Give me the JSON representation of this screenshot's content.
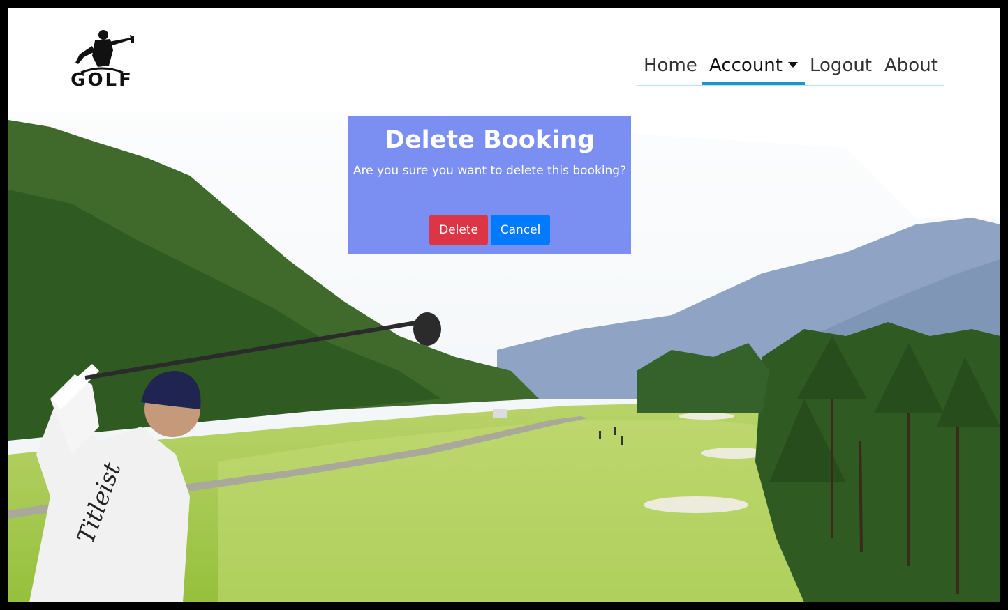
{
  "header": {
    "logo_text": "GOLF",
    "nav": {
      "home": "Home",
      "account": "Account",
      "logout": "Logout",
      "about": "About"
    }
  },
  "modal": {
    "title": "Delete Booking",
    "message": "Are you sure you want to delete this booking?",
    "delete_label": "Delete",
    "cancel_label": "Cancel"
  },
  "colors": {
    "modal_background": "#7b8ff2",
    "delete_button": "#dc3545",
    "cancel_button": "#007bff",
    "nav_active_underline": "#1e96c8"
  }
}
